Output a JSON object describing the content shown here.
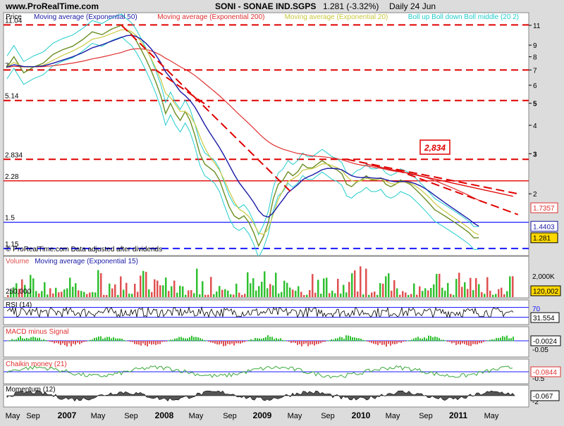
{
  "header": {
    "site": "www.ProRealTime.com",
    "title": "SONI - SONAE IND.SGPS",
    "quote": "1.281 (-3.32%)",
    "period": "Daily 24 Jun"
  },
  "colors": {
    "price": "#6b8e23",
    "ema50": "#1a1aa6",
    "ema200": "#e03030",
    "ema20": "#c8c840",
    "bollinger": "#22cccc",
    "dashed_red": "#e00000",
    "solid_red": "#e00000",
    "blue_line": "#1a1aff",
    "volume_up": "#30c030",
    "volume_down": "#e05050"
  },
  "chart_data": [
    {
      "type": "line",
      "name": "price-panel",
      "legend": [
        {
          "label": "Price",
          "color": "#000000"
        },
        {
          "label": "Moving average (Exponential 50)",
          "color": "#1a1aa6"
        },
        {
          "label": "Moving average (Exponential 200)",
          "color": "#e03030"
        },
        {
          "label": "Moving average (Exponential 20)",
          "color": "#c8c840"
        },
        {
          "label": "Boll up Boll down Boll middle (20 2)",
          "color": "#22cccc"
        }
      ],
      "y_scale": "log",
      "ylim": [
        1.07,
        12.5
      ],
      "right_ticks": [
        11,
        9,
        8,
        7,
        6,
        5,
        4,
        3,
        2
      ],
      "left_levels": [
        {
          "label": "11.04",
          "value": 11.04,
          "style": "dashed",
          "color": "#e00000"
        },
        {
          "label": "7",
          "value": 7,
          "style": "dashed",
          "color": "#e00000"
        },
        {
          "label": "5.14",
          "value": 5.14,
          "style": "dashed",
          "color": "#e00000"
        },
        {
          "label": "2.834",
          "value": 2.834,
          "style": "dashed",
          "color": "#e00000"
        },
        {
          "label": "2.28",
          "value": 2.28,
          "style": "solid",
          "color": "#e00000"
        },
        {
          "label": "1.5",
          "value": 1.5,
          "style": "solid",
          "color": "#1a1aff"
        },
        {
          "label": "1.15",
          "value": 1.15,
          "style": "dashed",
          "color": "#1a1aff"
        }
      ],
      "annotation": "2,834",
      "footnote": "© ProRealTime.com Data adjusted after dividends",
      "right_value_tags": [
        {
          "label": "1.7357",
          "value": 1.7357
        },
        {
          "label": "1.4403",
          "value": 1.4403
        },
        {
          "label": "1.281",
          "value": 1.281
        }
      ],
      "x": [
        2006.33,
        2006.4,
        2006.5,
        2006.6,
        2006.7,
        2006.8,
        2006.9,
        2007.0,
        2007.1,
        2007.2,
        2007.3,
        2007.4,
        2007.5,
        2007.55,
        2007.6,
        2007.65,
        2007.7,
        2007.75,
        2007.8,
        2007.85,
        2007.9,
        2007.95,
        2008.0,
        2008.05,
        2008.1,
        2008.15,
        2008.2,
        2008.25,
        2008.3,
        2008.35,
        2008.4,
        2008.45,
        2008.5,
        2008.55,
        2008.6,
        2008.65,
        2008.7,
        2008.75,
        2008.8,
        2008.85,
        2008.9,
        2008.95,
        2009.0,
        2009.05,
        2009.1,
        2009.15,
        2009.2,
        2009.25,
        2009.3,
        2009.35,
        2009.4,
        2009.45,
        2009.5,
        2009.55,
        2009.6,
        2009.65,
        2009.7,
        2009.75,
        2009.8,
        2009.85,
        2009.9,
        2009.95,
        2010.0,
        2010.05,
        2010.1,
        2010.15,
        2010.2,
        2010.25,
        2010.3,
        2010.35,
        2010.4,
        2010.45,
        2010.5,
        2010.55,
        2010.6,
        2010.65,
        2010.7,
        2010.75,
        2010.8,
        2010.85,
        2010.9,
        2010.95,
        2011.0,
        2011.05,
        2011.1,
        2011.15,
        2011.2,
        2011.25,
        2011.3,
        2011.35,
        2011.4,
        2011.45,
        2011.48
      ],
      "series": [
        {
          "name": "Price",
          "values": [
            7.2,
            8.0,
            6.8,
            7.2,
            7.5,
            8.2,
            8.6,
            8.9,
            9.5,
            10.3,
            10.0,
            10.6,
            11.0,
            10.5,
            10.1,
            9.4,
            8.6,
            7.8,
            7.0,
            6.2,
            5.4,
            4.5,
            5.0,
            4.5,
            4.2,
            4.6,
            4.2,
            3.6,
            3.0,
            2.7,
            2.6,
            2.5,
            2.3,
            2.0,
            1.75,
            1.6,
            1.55,
            1.6,
            1.5,
            1.35,
            1.18,
            1.3,
            1.5,
            1.9,
            2.2,
            2.3,
            2.5,
            2.4,
            2.5,
            2.7,
            2.6,
            2.6,
            2.7,
            2.8,
            2.7,
            2.6,
            2.55,
            2.45,
            2.2,
            2.15,
            2.25,
            2.3,
            2.4,
            2.3,
            2.3,
            2.35,
            2.2,
            2.15,
            2.2,
            2.3,
            2.25,
            2.2,
            2.1,
            2.0,
            1.9,
            1.8,
            1.7,
            1.65,
            1.6,
            1.55,
            1.5,
            1.45,
            1.4,
            1.35,
            1.28,
            1.281
          ]
        }
      ]
    },
    {
      "type": "bar",
      "name": "volume-panel",
      "legend": [
        {
          "label": "Volume",
          "color": "#e05050"
        },
        {
          "label": "Moving average (Exponential 15)",
          "color": "#1a1aa6"
        }
      ],
      "left_label": "250,000",
      "right_ticks": [
        "2,000K"
      ],
      "value_tag": "120,002"
    },
    {
      "type": "line",
      "name": "rsi-panel",
      "legend": [
        {
          "label": "RSI (14)",
          "color": "#000000"
        }
      ],
      "ylim": [
        0,
        100
      ],
      "levels": [
        30,
        70
      ],
      "right_ticks": [
        "70"
      ],
      "value_tag": "31.554"
    },
    {
      "type": "bar",
      "name": "macd-panel",
      "legend": [
        {
          "label": "MACD minus Signal",
          "color": "#e03030"
        }
      ],
      "right_ticks": [
        "-0.05"
      ],
      "value_tag": "-0.0024"
    },
    {
      "type": "line",
      "name": "chaikin-panel",
      "legend": [
        {
          "label": "Chaikin money (21)",
          "color": "#e03030"
        }
      ],
      "right_ticks": [
        "-0.5"
      ],
      "value_tag": "-0.0844"
    },
    {
      "type": "area",
      "name": "momentum-panel",
      "legend": [
        {
          "label": "Momentum (12)",
          "color": "#000000"
        }
      ],
      "right_ticks": [
        "-2"
      ],
      "value_tag": "-0.067"
    }
  ],
  "x_axis": {
    "ticks": [
      {
        "label": "May",
        "year": false
      },
      {
        "label": "Sep",
        "year": false
      },
      {
        "label": "2007",
        "year": true
      },
      {
        "label": "May",
        "year": false
      },
      {
        "label": "Sep",
        "year": false
      },
      {
        "label": "2008",
        "year": true
      },
      {
        "label": "May",
        "year": false
      },
      {
        "label": "Sep",
        "year": false
      },
      {
        "label": "2009",
        "year": true
      },
      {
        "label": "May",
        "year": false
      },
      {
        "label": "Sep",
        "year": false
      },
      {
        "label": "2010",
        "year": true
      },
      {
        "label": "May",
        "year": false
      },
      {
        "label": "Sep",
        "year": false
      },
      {
        "label": "2011",
        "year": true
      },
      {
        "label": "May",
        "year": false
      }
    ]
  }
}
